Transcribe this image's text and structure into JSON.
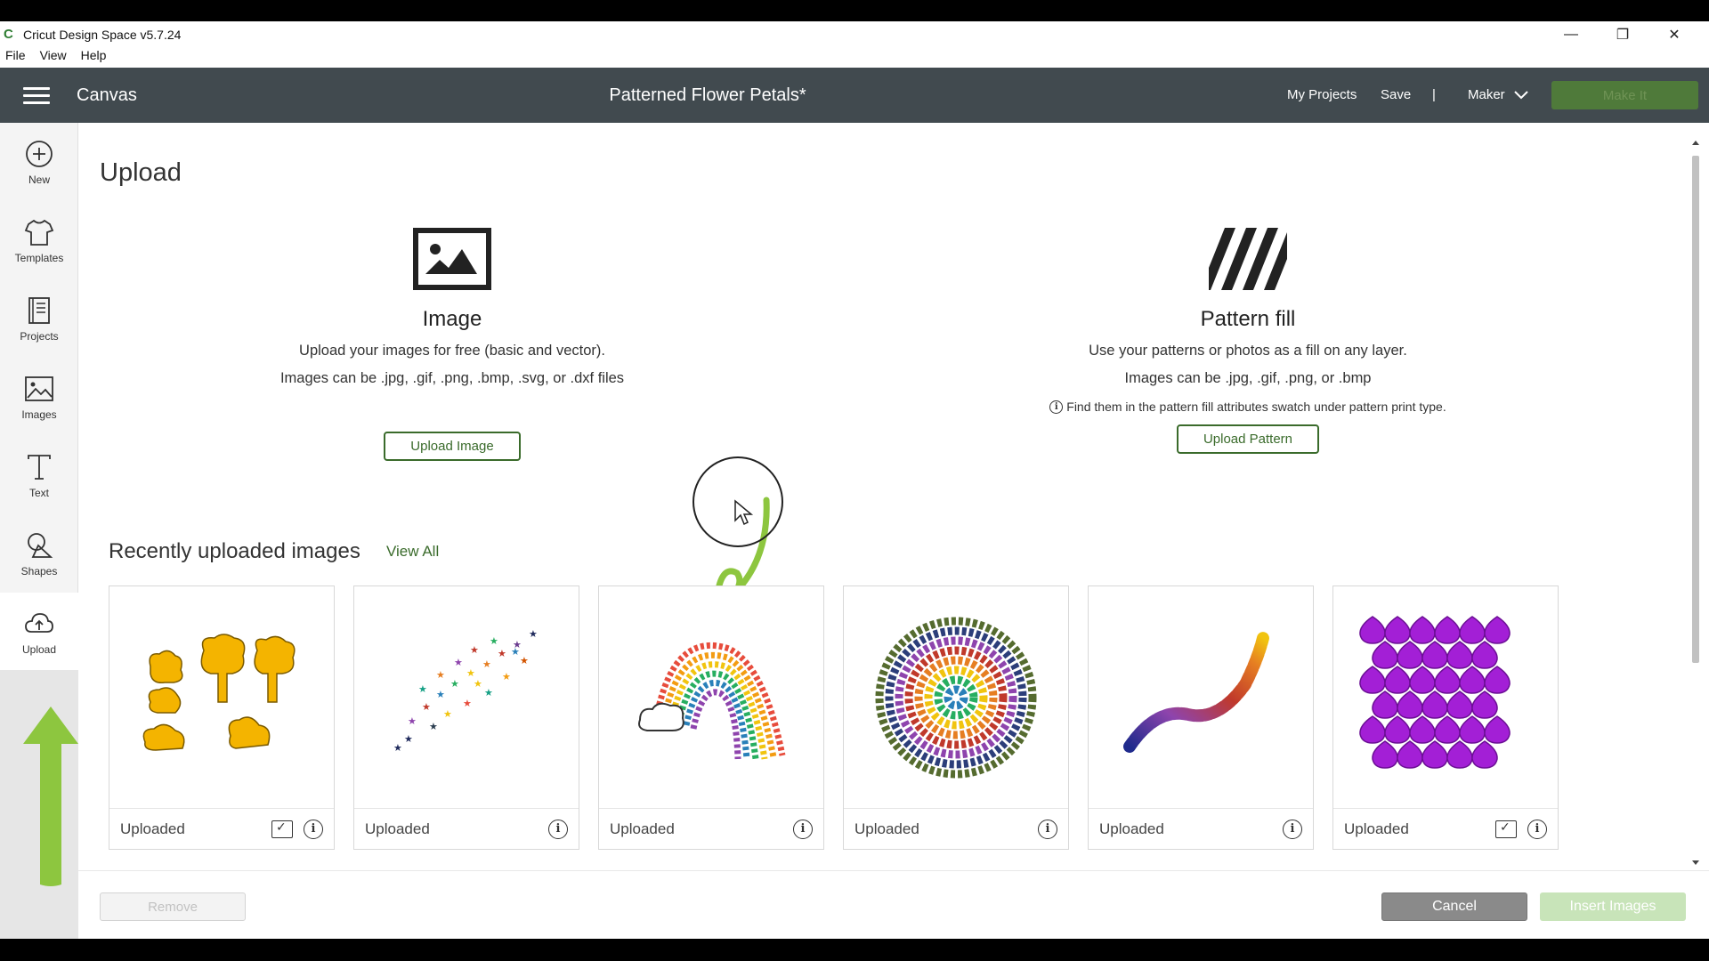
{
  "window": {
    "title": "Cricut Design Space  v5.7.24",
    "menu": [
      "File",
      "View",
      "Help"
    ],
    "controls": {
      "minimize": "—",
      "restore": "❐",
      "close": "✕"
    }
  },
  "header": {
    "section": "Canvas",
    "project_title": "Patterned Flower Petals*",
    "my_projects": "My Projects",
    "save": "Save",
    "separator": "|",
    "machine": "Maker",
    "make_it": "Make It"
  },
  "sidebar": {
    "items": [
      {
        "label": "New",
        "icon": "plus-circle-icon"
      },
      {
        "label": "Templates",
        "icon": "tshirt-icon"
      },
      {
        "label": "Projects",
        "icon": "book-icon"
      },
      {
        "label": "Images",
        "icon": "image-icon"
      },
      {
        "label": "Text",
        "icon": "text-icon"
      },
      {
        "label": "Shapes",
        "icon": "shapes-icon"
      },
      {
        "label": "Upload",
        "icon": "cloud-upload-icon"
      }
    ]
  },
  "upload": {
    "title": "Upload",
    "image": {
      "heading": "Image",
      "desc1": "Upload your images for free (basic and vector).",
      "desc2": "Images can be .jpg, .gif, .png, .bmp, .svg, or .dxf files",
      "button": "Upload Image"
    },
    "pattern": {
      "heading": "Pattern fill",
      "desc1": "Use your patterns or photos as a fill on any layer.",
      "desc2": "Images can be .jpg, .gif, .png, or .bmp",
      "note": "Find them in the pattern fill attributes swatch under pattern print type.",
      "button": "Upload Pattern"
    }
  },
  "recent": {
    "title": "Recently uploaded images",
    "view_all": "View All",
    "cards": [
      {
        "status": "Uploaded",
        "thumb": "yellow-trees",
        "cut_icon": true
      },
      {
        "status": "Uploaded",
        "thumb": "star-confetti",
        "cut_icon": false
      },
      {
        "status": "Uploaded",
        "thumb": "heart-rainbow",
        "cut_icon": false
      },
      {
        "status": "Uploaded",
        "thumb": "butterfly-wreath",
        "cut_icon": false
      },
      {
        "status": "Uploaded",
        "thumb": "butterfly-swarm",
        "cut_icon": false
      },
      {
        "status": "Uploaded",
        "thumb": "purple-scales",
        "cut_icon": true
      }
    ]
  },
  "footer": {
    "remove": "Remove",
    "cancel": "Cancel",
    "insert": "Insert Images"
  },
  "colors": {
    "header": "#414a4f",
    "accent_green": "#3a6b2b",
    "annotation_green": "#8dc63f",
    "make_it": "#4f7a3a"
  }
}
